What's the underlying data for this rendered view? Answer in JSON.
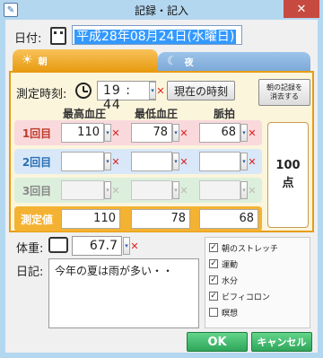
{
  "window": {
    "title": "記録・記入",
    "close_glyph": "✕",
    "app_glyph": "✎"
  },
  "date": {
    "label": "日付:",
    "value": "平成28年08月24日(水曜日)"
  },
  "tabs": [
    {
      "label": "朝",
      "icon": "sun-icon",
      "icon_glyph": "☀",
      "color": "#e89c12"
    },
    {
      "label": "夜",
      "icon": "moon-icon",
      "icon_glyph": "☾",
      "color": "#7ea9d8"
    }
  ],
  "measure": {
    "time_label": "測定時刻:",
    "time_value": "19 : 44",
    "now_button": "現在の時刻",
    "clear_button": "朝の記録を\n消去する"
  },
  "columns": [
    "最高血圧",
    "最低血圧",
    "脈拍"
  ],
  "rows": [
    {
      "label": "1回目",
      "values": [
        "110",
        "78",
        "68"
      ],
      "band_color": "#f9d9dc",
      "label_color": "#c0392b"
    },
    {
      "label": "2回目",
      "values": [
        "",
        "",
        ""
      ],
      "band_color": "#d8e8f8",
      "label_color": "#2a6fb5"
    },
    {
      "label": "3回目",
      "values": [
        "",
        "",
        ""
      ],
      "band_color": "#dcefdc",
      "label_color": "#777777"
    }
  ],
  "result": {
    "label": "測定値",
    "values": [
      "110",
      "78",
      "68"
    ]
  },
  "score": {
    "value": "100",
    "unit": "点"
  },
  "weight": {
    "label": "体重:",
    "value": "67.7"
  },
  "diary": {
    "label": "日記:",
    "text": "今年の夏は雨が多い・・"
  },
  "checklist": [
    {
      "label": "朝のストレッチ",
      "checked": true
    },
    {
      "label": "運動",
      "checked": true
    },
    {
      "label": "水分",
      "checked": true
    },
    {
      "label": "ビフィコロン",
      "checked": true
    },
    {
      "label": "瞑想",
      "checked": false
    }
  ],
  "buttons": {
    "ok": "OK",
    "cancel": "キャンセル"
  },
  "glyphs": {
    "spin": "▾",
    "clear_x": "✕",
    "check": "✓"
  }
}
